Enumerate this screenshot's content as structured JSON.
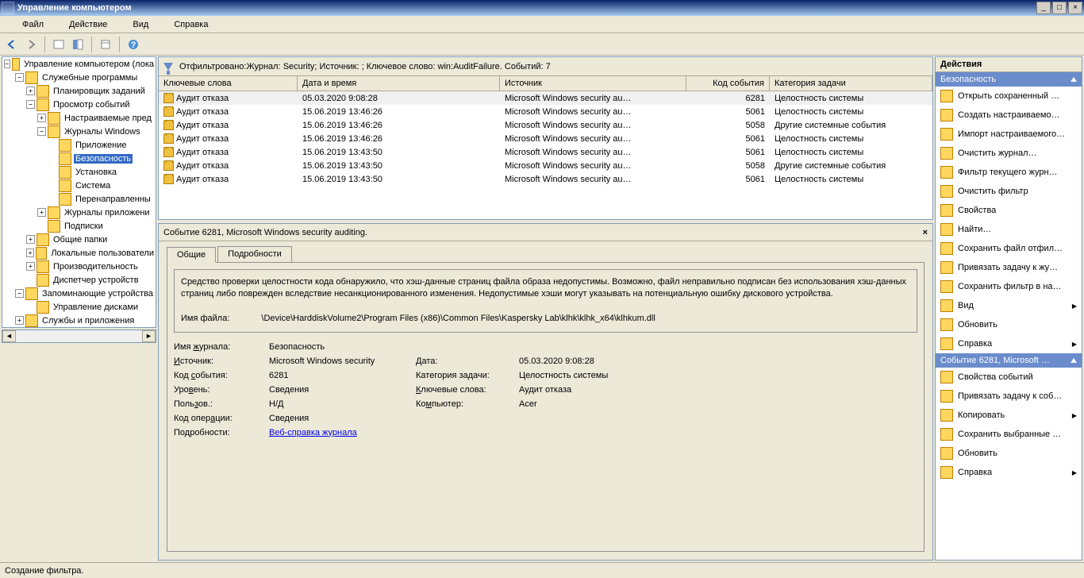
{
  "window": {
    "title": "Управление компьютером"
  },
  "menubar": {
    "file": "Файл",
    "action": "Действие",
    "view": "Вид",
    "help": "Справка"
  },
  "tree": {
    "items": [
      {
        "label": "Управление компьютером (лока",
        "depth": 0,
        "exp": "-",
        "icon": "computer"
      },
      {
        "label": "Служебные программы",
        "depth": 1,
        "exp": "-",
        "icon": "tools"
      },
      {
        "label": "Планировщик заданий",
        "depth": 2,
        "exp": "+",
        "icon": "sched"
      },
      {
        "label": "Просмотр событий",
        "depth": 2,
        "exp": "-",
        "icon": "event"
      },
      {
        "label": "Настраиваемые пред",
        "depth": 3,
        "exp": "+",
        "icon": "folder"
      },
      {
        "label": "Журналы Windows",
        "depth": 3,
        "exp": "-",
        "icon": "folder"
      },
      {
        "label": "Приложение",
        "depth": 4,
        "exp": " ",
        "icon": "log"
      },
      {
        "label": "Безопасность",
        "depth": 4,
        "exp": " ",
        "icon": "log",
        "selected": true
      },
      {
        "label": "Установка",
        "depth": 4,
        "exp": " ",
        "icon": "log"
      },
      {
        "label": "Система",
        "depth": 4,
        "exp": " ",
        "icon": "log"
      },
      {
        "label": "Перенаправленны",
        "depth": 4,
        "exp": " ",
        "icon": "log"
      },
      {
        "label": "Журналы приложени",
        "depth": 3,
        "exp": "+",
        "icon": "folder"
      },
      {
        "label": "Подписки",
        "depth": 3,
        "exp": " ",
        "icon": "sub"
      },
      {
        "label": "Общие папки",
        "depth": 2,
        "exp": "+",
        "icon": "share"
      },
      {
        "label": "Локальные пользователи",
        "depth": 2,
        "exp": "+",
        "icon": "users"
      },
      {
        "label": "Производительность",
        "depth": 2,
        "exp": "+",
        "icon": "perf"
      },
      {
        "label": "Диспетчер устройств",
        "depth": 2,
        "exp": " ",
        "icon": "devmgr"
      },
      {
        "label": "Запоминающие устройства",
        "depth": 1,
        "exp": "-",
        "icon": "storage"
      },
      {
        "label": "Управление дисками",
        "depth": 2,
        "exp": " ",
        "icon": "disk"
      },
      {
        "label": "Службы и приложения",
        "depth": 1,
        "exp": "+",
        "icon": "services"
      }
    ]
  },
  "filter_bar": "Отфильтровано:Журнал: Security; Источник: ; Ключевое слово: win:AuditFailure. Событий: 7",
  "columns": {
    "key": "Ключевые слова",
    "date": "Дата и время",
    "src": "Источник",
    "id": "Код события",
    "cat": "Категория задачи"
  },
  "audit_fail": "Аудит отказа",
  "src_text": "Microsoft Windows security au…",
  "events": [
    {
      "date": "05.03.2020 9:08:28",
      "id": "6281",
      "cat": "Целостность системы",
      "sel": true
    },
    {
      "date": "15.06.2019 13:46:26",
      "id": "5061",
      "cat": "Целостность системы"
    },
    {
      "date": "15.06.2019 13:46:26",
      "id": "5058",
      "cat": "Другие системные события"
    },
    {
      "date": "15.06.2019 13:46:26",
      "id": "5061",
      "cat": "Целостность системы"
    },
    {
      "date": "15.06.2019 13:43:50",
      "id": "5061",
      "cat": "Целостность системы"
    },
    {
      "date": "15.06.2019 13:43:50",
      "id": "5058",
      "cat": "Другие системные события"
    },
    {
      "date": "15.06.2019 13:43:50",
      "id": "5061",
      "cat": "Целостность системы"
    }
  ],
  "detail": {
    "header": "Событие 6281, Microsoft Windows security auditing.",
    "tabs": {
      "general": "Общие",
      "details": "Подробности"
    },
    "message": "Средство проверки целостности кода обнаружило, что хэш-данные страниц файла образа недопустимы. Возможно, файл неправильно подписан без использования хэш-данных страниц либо поврежден вследствие несанкционированного изменения. Недопустимые хэши могут указывать на потенциальную ошибку дискового устройства.",
    "file_label": "Имя файла:",
    "file_value": "\\Device\\HarddiskVolume2\\Program Files (x86)\\Common Files\\Kaspersky Lab\\klhk\\klhk_x64\\klhkum.dll",
    "props": {
      "log_label": "Имя журнала:",
      "log_value": "Безопасность",
      "source_label": "Источник:",
      "source_value": "Microsoft Windows security",
      "date_label": "Дата:",
      "date_value": "05.03.2020 9:08:28",
      "id_label": "Код события:",
      "id_value": "6281",
      "cat_label": "Категория задачи:",
      "cat_value": "Целостность системы",
      "level_label": "Уровень:",
      "level_value": "Сведения",
      "kw_label": "Ключевые слова:",
      "kw_value": "Аудит отказа",
      "user_label": "Пользов.:",
      "user_value": "Н/Д",
      "comp_label": "Компьютер:",
      "comp_value": "Acer",
      "op_label": "Код операции:",
      "op_value": "Сведения",
      "more_label": "Подробности:",
      "more_link": "Веб-справка журнала"
    }
  },
  "actions": {
    "title": "Действия",
    "section1": "Безопасность",
    "items1": [
      {
        "label": "Открыть сохраненный …"
      },
      {
        "label": "Создать настраиваемо…"
      },
      {
        "label": "Импорт настраиваемого…"
      },
      {
        "label": "Очистить журнал…"
      },
      {
        "label": "Фильтр текущего журн…"
      },
      {
        "label": "Очистить фильтр"
      },
      {
        "label": "Свойства"
      },
      {
        "label": "Найти…"
      },
      {
        "label": "Сохранить файл отфил…"
      },
      {
        "label": "Привязать задачу к жу…"
      },
      {
        "label": "Сохранить фильтр в на…"
      },
      {
        "label": "Вид",
        "arrow": true
      },
      {
        "label": "Обновить"
      },
      {
        "label": "Справка",
        "arrow": true
      }
    ],
    "section2": "Событие 6281, Microsoft …",
    "items2": [
      {
        "label": "Свойства событий"
      },
      {
        "label": "Привязать задачу к соб…"
      },
      {
        "label": "Копировать",
        "arrow": true
      },
      {
        "label": "Сохранить выбранные …"
      },
      {
        "label": "Обновить"
      },
      {
        "label": "Справка",
        "arrow": true
      }
    ]
  },
  "statusbar": "Создание фильтра."
}
